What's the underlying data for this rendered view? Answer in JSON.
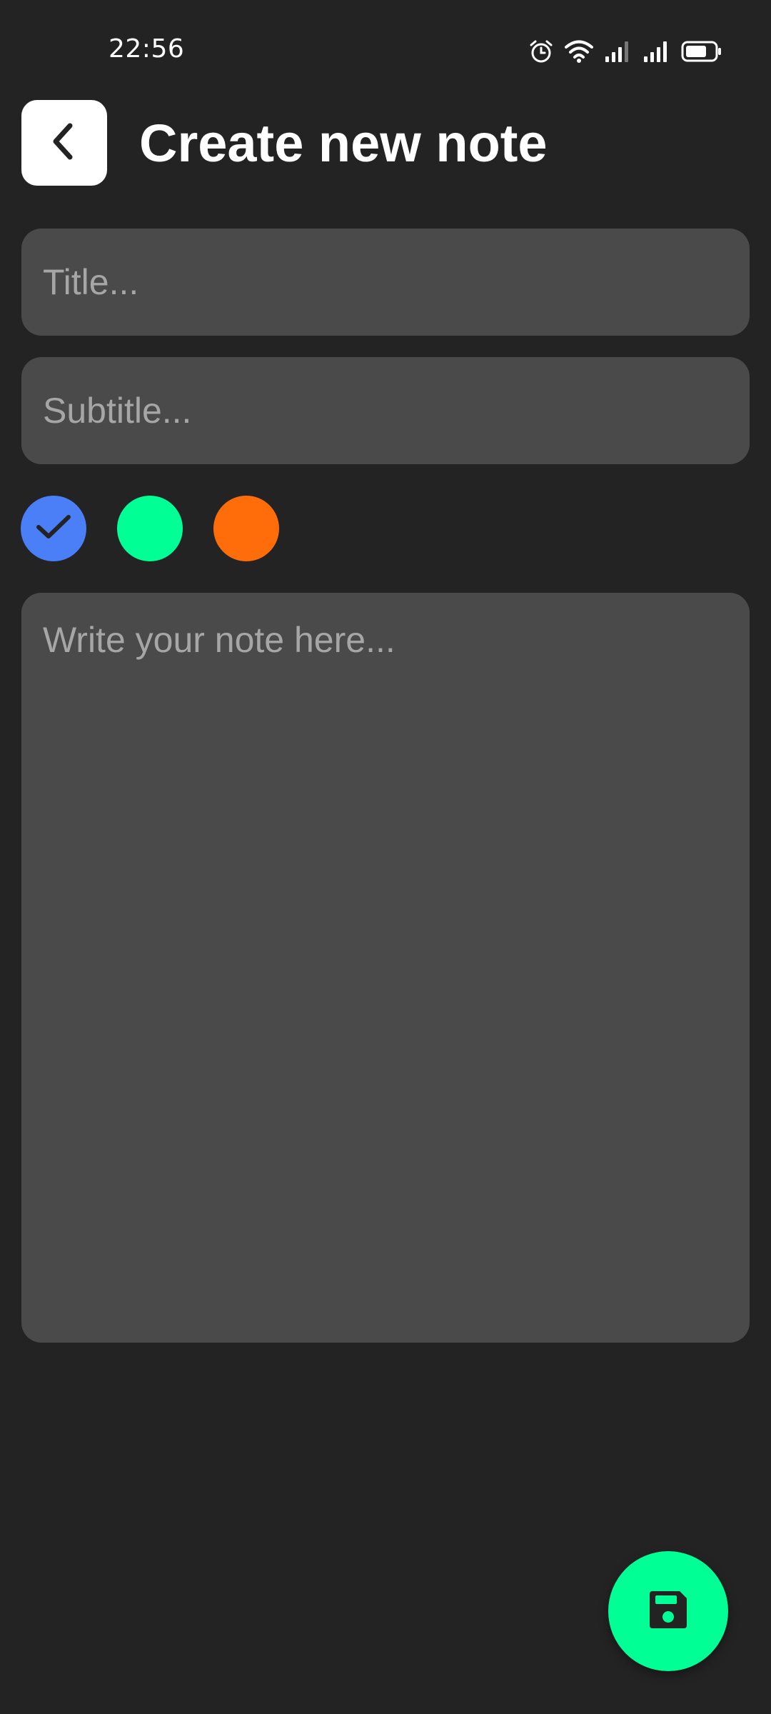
{
  "status_bar": {
    "time": "22:56",
    "icons": [
      "alarm-icon",
      "wifi-icon",
      "signal-sim1-icon",
      "signal-sim2-icon",
      "battery-icon"
    ]
  },
  "header": {
    "back_icon": "chevron-left-icon",
    "title": "Create new note"
  },
  "form": {
    "title_placeholder": "Title...",
    "title_value": "",
    "subtitle_placeholder": "Subtitle...",
    "subtitle_value": "",
    "note_placeholder": "Write your note here...",
    "note_value": ""
  },
  "colors": {
    "background": "#232323",
    "field": "#4a4a4a",
    "placeholder": "#a6a6a6",
    "options": [
      {
        "name": "blue",
        "hex": "#4a7ff7",
        "selected": true
      },
      {
        "name": "green",
        "hex": "#00ff94",
        "selected": false
      },
      {
        "name": "orange",
        "hex": "#ff6c0a",
        "selected": false
      }
    ],
    "fab": "#00ff94"
  },
  "fab": {
    "icon": "save-icon"
  }
}
